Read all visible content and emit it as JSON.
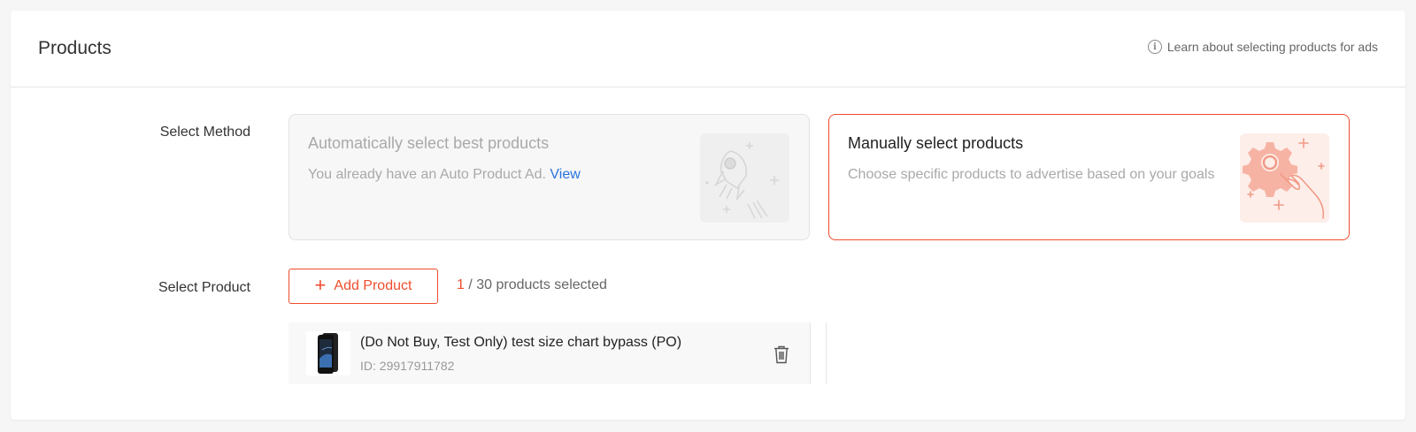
{
  "header": {
    "title": "Products",
    "help_text": "Learn about selecting products for ads",
    "help_icon": "info-icon"
  },
  "select_method": {
    "label": "Select Method",
    "auto": {
      "title": "Automatically select best products",
      "desc": "You already have an Auto Product Ad.",
      "link": "View",
      "illustration": "rocket-icon",
      "state": "disabled"
    },
    "manual": {
      "title": "Manually select products",
      "desc": "Choose specific products to advertise based on your goals",
      "illustration": "gear-hand-icon",
      "state": "selected"
    }
  },
  "select_product": {
    "label": "Select Product",
    "add_button": "Add Product",
    "selected_count": "1",
    "count_suffix": " / 30 products selected",
    "products": [
      {
        "name": "(Do Not Buy, Test Only) test size chart bypass (PO)",
        "id": "ID: 29917911782",
        "thumbnail": "phone-thumbnail"
      }
    ]
  },
  "colors": {
    "accent": "#ee4d2d",
    "link": "#2673dd",
    "muted": "#a9a9a9"
  }
}
